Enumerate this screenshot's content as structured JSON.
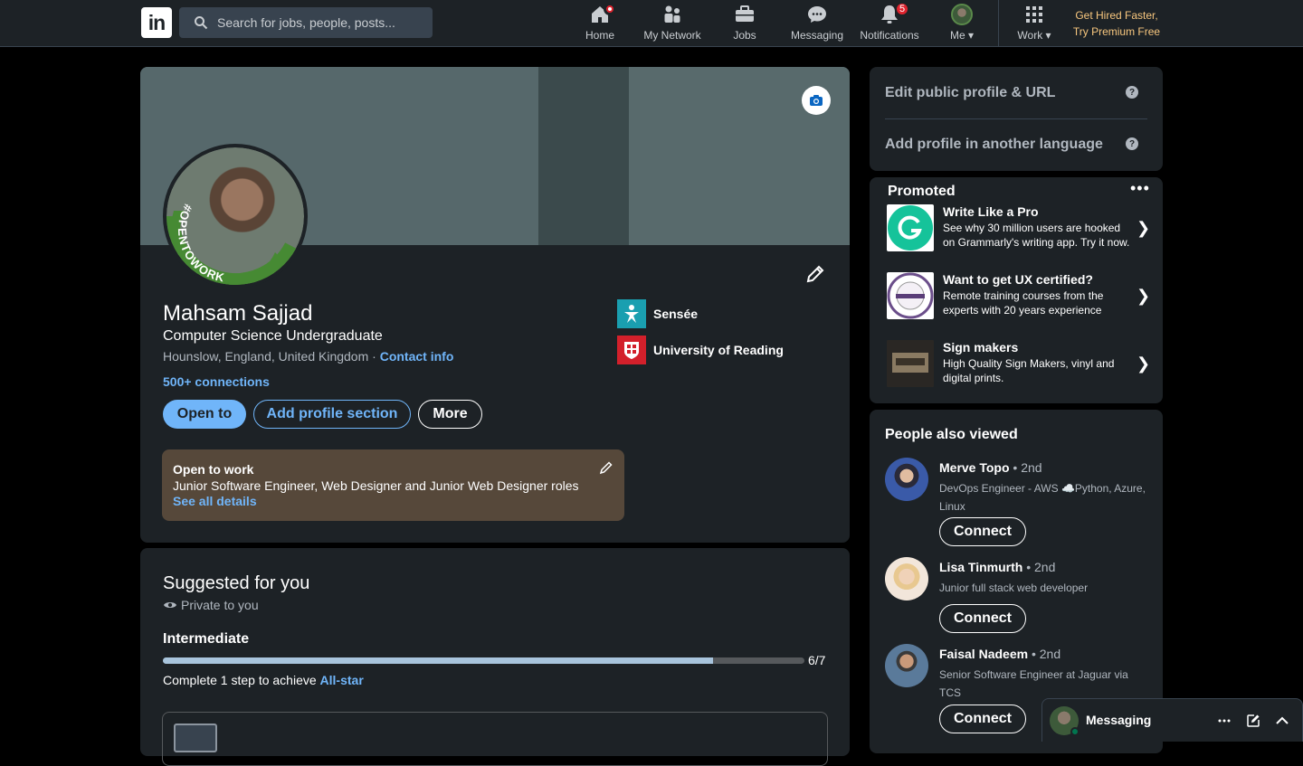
{
  "nav": {
    "logo": "in",
    "search_placeholder": "Search for jobs, people, posts...",
    "items": [
      {
        "label": "Home",
        "icon": "home-icon",
        "badge": ""
      },
      {
        "label": "My Network",
        "icon": "network-icon",
        "badge": ""
      },
      {
        "label": "Jobs",
        "icon": "briefcase-icon",
        "badge": ""
      },
      {
        "label": "Messaging",
        "icon": "messaging-icon",
        "badge": ""
      },
      {
        "label": "Notifications",
        "icon": "bell-icon",
        "badge": "5"
      },
      {
        "label": "Me",
        "icon": "avatar",
        "badge": ""
      },
      {
        "label": "Work",
        "icon": "grid-icon",
        "badge": ""
      }
    ],
    "premium_line1": "Get Hired Faster,",
    "premium_line2": "Try Premium Free"
  },
  "profile": {
    "name": "Mahsam Sajjad",
    "headline": "Computer Science Undergraduate",
    "location": "Hounslow, England, United Kingdom",
    "location_sep": " · ",
    "contact_info": "Contact info",
    "connections": "500+ connections",
    "open_to_label": "Open to",
    "add_section_label": "Add profile section",
    "more_label": "More",
    "photo_frame_text": "#OPENTOWORK",
    "companies": [
      {
        "name": "Sensée",
        "color": "#1a9fb0"
      },
      {
        "name": "University of Reading",
        "color": "#d3202b"
      }
    ],
    "open_to_work": {
      "title": "Open to work",
      "roles": "Junior Software Engineer, Web Designer and Junior Web Designer roles",
      "details_link": "See all details"
    }
  },
  "suggested": {
    "title": "Suggested for you",
    "private": "Private to you",
    "level": "Intermediate",
    "progress_fraction": 0.857,
    "progress_label": "6/7",
    "step_text": "Complete 1 step to achieve ",
    "step_link": "All-star"
  },
  "sidebar": {
    "edit_public_profile": "Edit public profile & URL",
    "add_language": "Add profile in another language",
    "promoted_title": "Promoted",
    "more_dots": "•••",
    "ads": [
      {
        "title": "Write Like a Pro",
        "body": "See why 30 million users are hooked on Grammarly's writing app. Try it now."
      },
      {
        "title": "Want to get UX certified?",
        "body": "Remote training courses from the experts with 20 years experience"
      },
      {
        "title": "Sign makers",
        "body": "High Quality Sign Makers, vinyl and digital prints."
      }
    ],
    "people_title": "People also viewed",
    "people": [
      {
        "name": "Merve Topo",
        "degree": " • 2nd",
        "desc": "DevOps Engineer - AWS ☁️Python, Azure, Linux",
        "connect": "Connect"
      },
      {
        "name": "Lisa Tinmurth",
        "degree": " • 2nd",
        "desc": "Junior full stack web developer",
        "connect": "Connect"
      },
      {
        "name": "Faisal Nadeem",
        "degree": " • 2nd",
        "desc": "Senior Software Engineer at Jaguar via TCS",
        "connect": "Connect"
      }
    ]
  },
  "messaging": {
    "title": "Messaging"
  },
  "colors": {
    "accent": "#70b5f9",
    "background": "#000000",
    "card": "#1d2226",
    "premium": "#f8c77e",
    "badge": "#e0232e"
  }
}
